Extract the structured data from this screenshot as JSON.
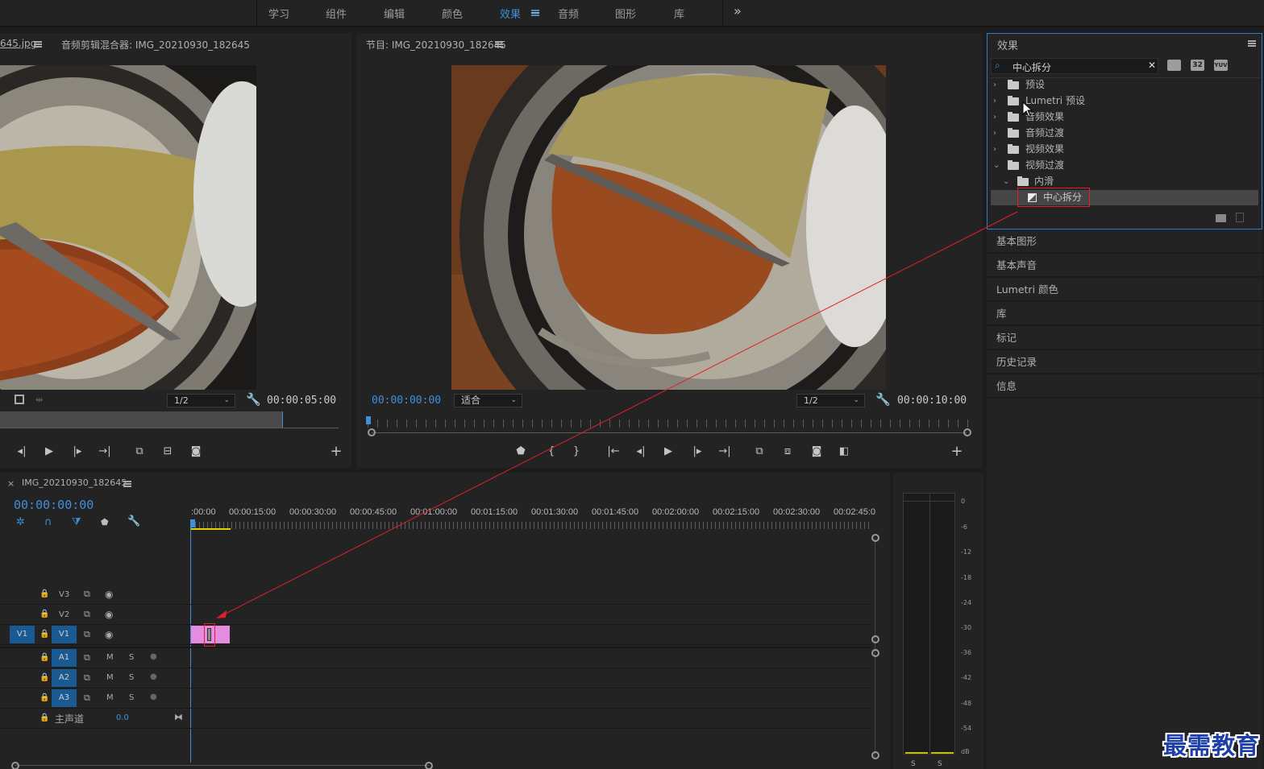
{
  "workspace": {
    "tabs": [
      "学习",
      "组件",
      "编辑",
      "颜色",
      "效果",
      "音频",
      "图形",
      "库"
    ],
    "active_tab": "效果",
    "more": "»"
  },
  "source_panel": {
    "tab1": "645.jpg",
    "tab2": "音频剪辑混合器: IMG_20210930_182645",
    "zoom": "1/2",
    "timecode": "00:00:05:00"
  },
  "program_panel": {
    "title": "节目: IMG_20210930_182645",
    "timecode": "00:00:00:00",
    "fit": "适合",
    "zoom": "1/2",
    "duration": "00:00:10:00"
  },
  "effects_panel": {
    "title": "效果",
    "search_value": "中心拆分",
    "badges": [
      "32",
      "YUV"
    ],
    "tree": [
      {
        "label": "预设",
        "level": 0,
        "expanded": false
      },
      {
        "label": "Lumetri 预设",
        "level": 0,
        "expanded": false
      },
      {
        "label": "音频效果",
        "level": 0,
        "expanded": false
      },
      {
        "label": "音频过渡",
        "level": 0,
        "expanded": false
      },
      {
        "label": "视频效果",
        "level": 0,
        "expanded": false
      },
      {
        "label": "视频过渡",
        "level": 0,
        "expanded": true
      },
      {
        "label": "内滑",
        "level": 1,
        "expanded": true
      },
      {
        "label": "中心拆分",
        "level": 2,
        "selected": true
      }
    ]
  },
  "side_panels": [
    "基本图形",
    "基本声音",
    "Lumetri 颜色",
    "库",
    "标记",
    "历史记录",
    "信息"
  ],
  "timeline": {
    "sequence_name": "IMG_20210930_182645",
    "close": "×",
    "timecode": "00:00:00:00",
    "ruler_labels": [
      ":00:00",
      "00:00:15:00",
      "00:00:30:00",
      "00:00:45:00",
      "00:01:00:00",
      "00:01:15:00",
      "00:01:30:00",
      "00:01:45:00",
      "00:02:00:00",
      "00:02:15:00",
      "00:02:30:00",
      "00:02:45:0"
    ],
    "video_tracks": [
      "V3",
      "V2",
      "V1"
    ],
    "source_patch": "V1",
    "audio_tracks": [
      "A1",
      "A2",
      "A3"
    ],
    "m_label": "M",
    "s_label": "S",
    "master": {
      "label": "主声道",
      "value": "0.0"
    }
  },
  "audio_meter": {
    "scale": [
      "0",
      "-6",
      "-12",
      "-18",
      "-24",
      "-30",
      "-36",
      "-42",
      "-48",
      "-54",
      "dB"
    ],
    "solo": [
      "S",
      "S"
    ]
  },
  "watermark": "最需教育",
  "colors": {
    "accent": "#3f8fd8",
    "clip": "#e58be0",
    "track_blue": "#1a5a92",
    "annotation": "#e0202a"
  }
}
